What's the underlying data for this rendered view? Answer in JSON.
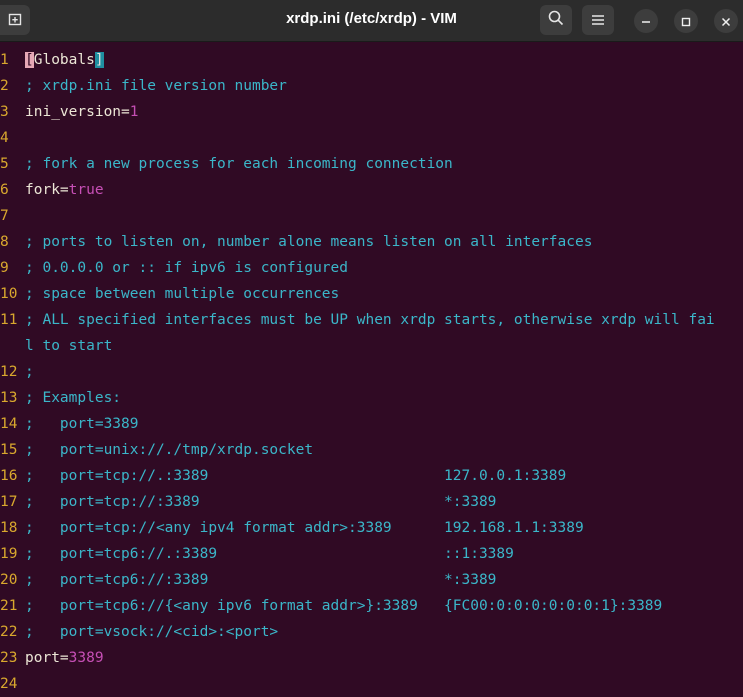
{
  "window": {
    "title": "xrdp.ini (/etc/xrdp) - VIM"
  },
  "icons": {
    "newtab": "new-tab-icon",
    "search": "search-icon",
    "menu": "hamburger-menu-icon",
    "minimize": "minimize-icon",
    "maximize": "maximize-icon",
    "close": "close-icon"
  },
  "colors": {
    "background": "#300a24",
    "line_number": "#d9a82e",
    "comment": "#3bb6c9",
    "value": "#c64fb5"
  },
  "lines": [
    {
      "n": "1",
      "parts": [
        {
          "t": "[",
          "c": "cursor"
        },
        {
          "t": "Globals",
          "c": "sec"
        },
        {
          "t": "]",
          "c": "brk"
        }
      ]
    },
    {
      "n": "2",
      "parts": [
        {
          "t": "; xrdp.ini file version number",
          "c": "comment"
        }
      ]
    },
    {
      "n": "3",
      "parts": [
        {
          "t": "ini_version",
          "c": "key"
        },
        {
          "t": "=",
          "c": "op"
        },
        {
          "t": "1",
          "c": "val"
        }
      ]
    },
    {
      "n": "4",
      "parts": []
    },
    {
      "n": "5",
      "parts": [
        {
          "t": "; fork a new process for each incoming connection",
          "c": "comment"
        }
      ]
    },
    {
      "n": "6",
      "parts": [
        {
          "t": "fork",
          "c": "key"
        },
        {
          "t": "=",
          "c": "op"
        },
        {
          "t": "true",
          "c": "val"
        }
      ]
    },
    {
      "n": "7",
      "parts": []
    },
    {
      "n": "8",
      "parts": [
        {
          "t": "; ports to listen on, number alone means listen on all interfaces",
          "c": "comment"
        }
      ]
    },
    {
      "n": "9",
      "parts": [
        {
          "t": "; 0.0.0.0 or :: if ipv6 is configured",
          "c": "comment"
        }
      ]
    },
    {
      "n": "10",
      "parts": [
        {
          "t": "; space between multiple occurrences",
          "c": "comment"
        }
      ]
    },
    {
      "n": "11",
      "parts": [
        {
          "t": "; ALL specified interfaces must be UP when xrdp starts, otherwise xrdp will fai",
          "c": "comment"
        }
      ]
    },
    {
      "n": "",
      "parts": [
        {
          "t": "l to start",
          "c": "comment"
        }
      ]
    },
    {
      "n": "12",
      "parts": [
        {
          "t": ";",
          "c": "comment"
        }
      ]
    },
    {
      "n": "13",
      "parts": [
        {
          "t": "; Examples:",
          "c": "comment"
        }
      ]
    },
    {
      "n": "14",
      "parts": [
        {
          "t": ";   port=3389",
          "c": "comment"
        }
      ]
    },
    {
      "n": "15",
      "parts": [
        {
          "t": ";   port=unix://./tmp/xrdp.socket",
          "c": "comment"
        }
      ]
    },
    {
      "n": "16",
      "parts": [
        {
          "t": ";   port=tcp://.:3389                           127.0.0.1:3389",
          "c": "comment"
        }
      ]
    },
    {
      "n": "17",
      "parts": [
        {
          "t": ";   port=tcp://:3389                            *:3389",
          "c": "comment"
        }
      ]
    },
    {
      "n": "18",
      "parts": [
        {
          "t": ";   port=tcp://<any ipv4 format addr>:3389      192.168.1.1:3389",
          "c": "comment"
        }
      ]
    },
    {
      "n": "19",
      "parts": [
        {
          "t": ";   port=tcp6://.:3389                          ::1:3389",
          "c": "comment"
        }
      ]
    },
    {
      "n": "20",
      "parts": [
        {
          "t": ";   port=tcp6://:3389                           *:3389",
          "c": "comment"
        }
      ]
    },
    {
      "n": "21",
      "parts": [
        {
          "t": ";   port=tcp6://{<any ipv6 format addr>}:3389   {FC00:0:0:0:0:0:0:1}:3389",
          "c": "comment"
        }
      ]
    },
    {
      "n": "22",
      "parts": [
        {
          "t": ";   port=vsock://<cid>:<port>",
          "c": "comment"
        }
      ]
    },
    {
      "n": "23",
      "parts": [
        {
          "t": "port",
          "c": "key"
        },
        {
          "t": "=",
          "c": "op"
        },
        {
          "t": "3389",
          "c": "val"
        }
      ]
    },
    {
      "n": "24",
      "parts": []
    }
  ]
}
